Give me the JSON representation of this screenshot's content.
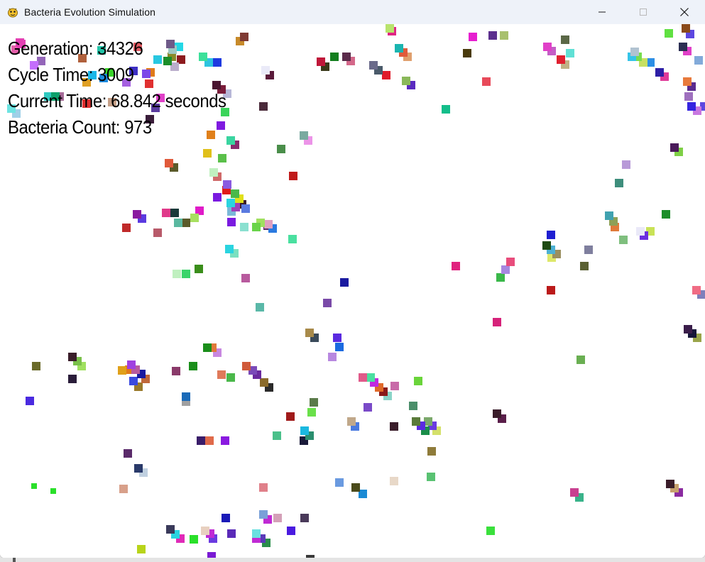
{
  "window": {
    "title": "Bacteria Evolution Simulation",
    "icons": {
      "app": "python-snake-icon",
      "minimize": "minimize-icon",
      "maximize": "maximize-icon",
      "close": "close-icon"
    }
  },
  "hud": {
    "generation": "Generation: 34326",
    "cycle_time": "Cycle Time: 3009",
    "current_time": "Current Time: 68.842 seconds",
    "bacteria_count": "Bacteria Count: 973"
  },
  "colors": {
    "titlebar": "#eef2f9",
    "canvas": "#ffffff",
    "hud_text": "#000000"
  }
}
